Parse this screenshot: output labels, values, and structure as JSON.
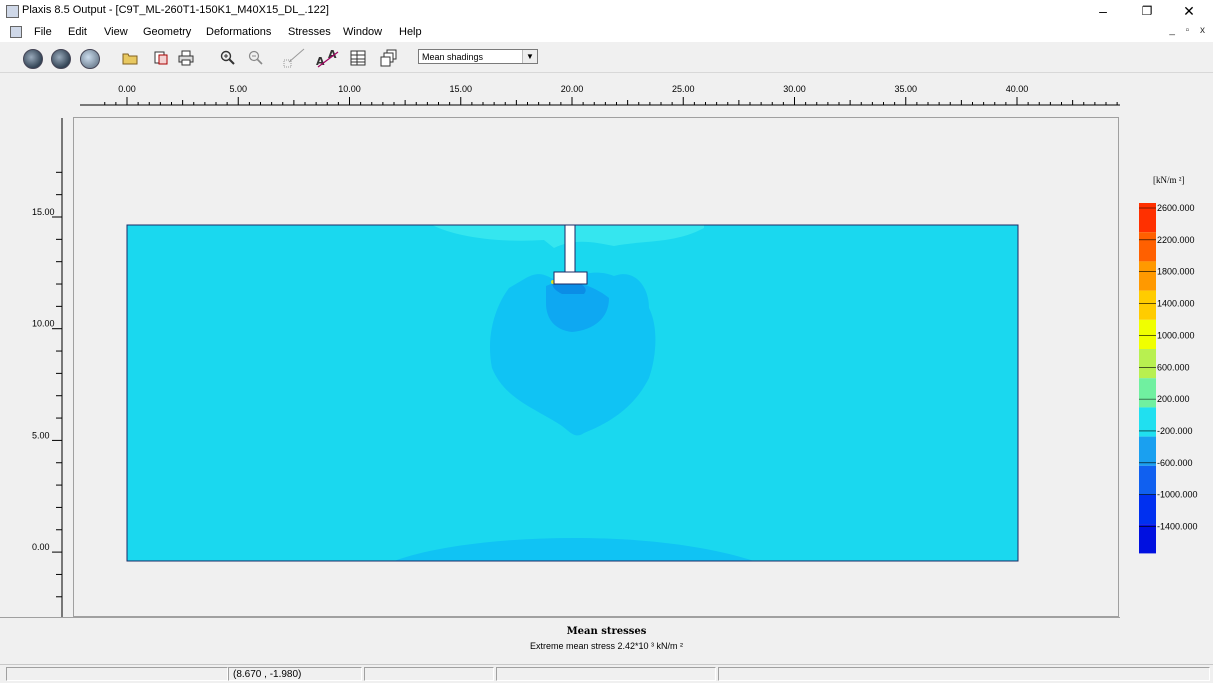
{
  "window": {
    "title": "Plaxis 8.5 Output - [C9T_ML-260T1-150K1_M40X15_DL_.122]",
    "controls": [
      "–",
      "❐",
      "✕"
    ]
  },
  "menu": {
    "items": [
      "File",
      "Edit",
      "View",
      "Geometry",
      "Deformations",
      "Stresses",
      "Window",
      "Help"
    ],
    "mdi_controls": "_ ▫ x"
  },
  "toolbar": {
    "display_select": "Mean shadings"
  },
  "axes": {
    "x_ticks": [
      "0.00",
      "5.00",
      "10.00",
      "15.00",
      "20.00",
      "25.00",
      "30.00",
      "35.00",
      "40.00"
    ],
    "y_ticks": [
      "15.00",
      "10.00",
      "5.00",
      "0.00"
    ]
  },
  "legend": {
    "unit": "[kN/m ²]",
    "values": [
      "2600.000",
      "2200.000",
      "1800.000",
      "1400.000",
      "1000.000",
      "600.000",
      "200.000",
      "-200.000",
      "-600.000",
      "-1000.000",
      "-1400.000"
    ],
    "colors": [
      "#ff3000",
      "#ff6000",
      "#ff9900",
      "#ffcc00",
      "#f0ff00",
      "#b8f050",
      "#70f0a0",
      "#20e0f0",
      "#1aa0f0",
      "#1060f0",
      "#0030f0",
      "#0010e0"
    ]
  },
  "plot": {
    "colors": {
      "base": "#1ad8ef",
      "mid": "#10c3f4",
      "deep": "#0ea8f2",
      "core": "#0b8de6",
      "top_light": "#35e6ef"
    }
  },
  "caption": {
    "title": "Mean stresses",
    "subtitle": "Extreme mean stress 2.42*10 ³ kN/m ²"
  },
  "status": {
    "coords": "(8.670 , -1.980)"
  }
}
